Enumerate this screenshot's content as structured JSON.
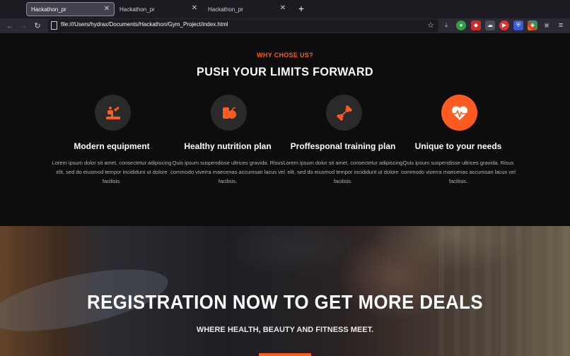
{
  "browser": {
    "tabs": [
      {
        "label": "Hackathon_pr",
        "active": true
      },
      {
        "label": "Hackathon_pr",
        "active": false
      },
      {
        "label": "Hackathon_pr",
        "active": false
      }
    ],
    "new_tab": "+",
    "url": "file:///Users/hydrax/Documents/Hackathon/Gym_Project/index.html"
  },
  "section": {
    "eyebrow": "WHY CHOSE US?",
    "title": "PUSH YOUR LIMITS FORWARD",
    "features": [
      {
        "icon": "treadmill-icon",
        "title": "Modern equipment",
        "text": "Lorem ipsum dolor sit amet, consectetur adipiscing elit, sed do eiusmod tempor incididunt ut dolore facilisis."
      },
      {
        "icon": "nutrition-icon",
        "title": "Healthy nutrition plan",
        "text": "Quis ipsum suspendisse ultrices gravida. Risus commodo viverra maecenas accumsan lacus vel facilisis."
      },
      {
        "icon": "dumbbell-icon",
        "title": "Proffesponal training plan",
        "text": "Lorem ipsum dolor sit amet, consectetur adipiscing elit, sed do eiusmod tempor incididunt ut dolore facilisis."
      },
      {
        "icon": "heart-pulse-icon",
        "title": "Unique to your needs",
        "text": "Quis ipsum suspendisse ultrices gravida. Risus commodo viverra maecenas accumsan lacus vel facilisis."
      }
    ]
  },
  "hero": {
    "title": "REGISTRATION NOW TO GET MORE DEALS",
    "subtitle": "WHERE HEALTH, BEAUTY AND FITNESS MEET."
  },
  "colors": {
    "accent": "#ff5a1f",
    "page_bg": "#0d0d0d",
    "icon_bg": "#2a2a2a"
  }
}
